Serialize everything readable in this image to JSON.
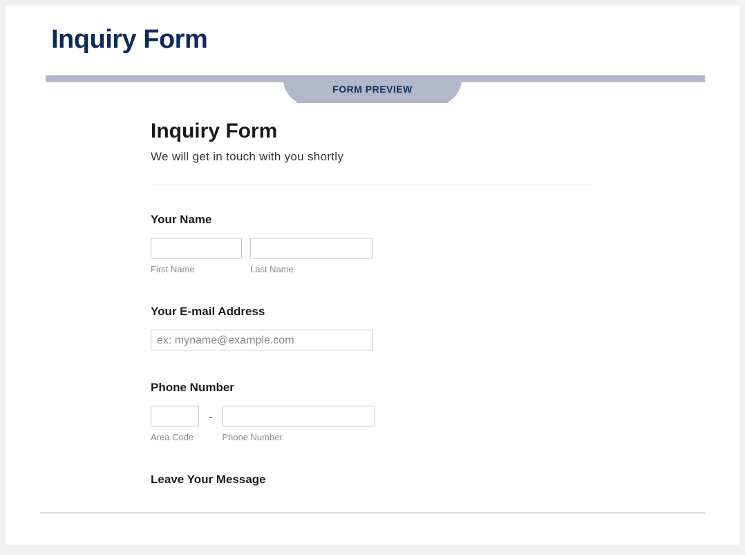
{
  "page": {
    "title": "Inquiry Form"
  },
  "preview": {
    "label": "FORM PREVIEW"
  },
  "form": {
    "title": "Inquiry Form",
    "subtitle": "We will get in touch with you shortly",
    "name": {
      "label": "Your Name",
      "first_sub": "First Name",
      "last_sub": "Last Name",
      "first_value": "",
      "last_value": ""
    },
    "email": {
      "label": "Your E-mail Address",
      "placeholder": "ex: myname@example.com",
      "value": ""
    },
    "phone": {
      "label": "Phone Number",
      "area_sub": "Area Code",
      "number_sub": "Phone Number",
      "separator": "-",
      "area_value": "",
      "number_value": ""
    },
    "message": {
      "label": "Leave Your Message"
    }
  }
}
